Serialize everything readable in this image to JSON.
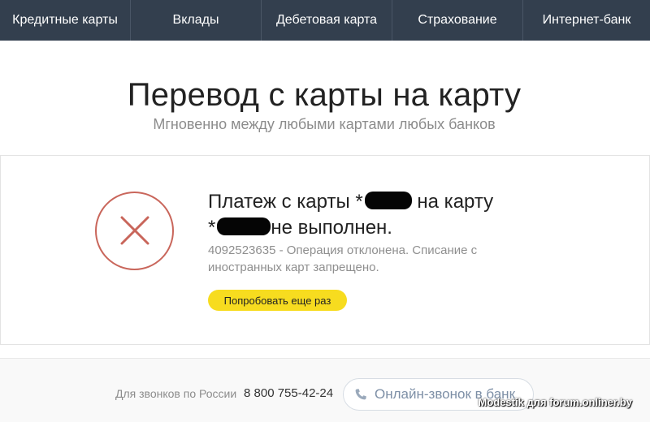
{
  "nav": {
    "items": [
      {
        "label": "Кредитные карты"
      },
      {
        "label": "Вклады"
      },
      {
        "label": "Дебетовая карта"
      },
      {
        "label": "Страхование"
      },
      {
        "label": "Интернет-банк"
      }
    ]
  },
  "header": {
    "title": "Перевод с карты на карту",
    "subtitle": "Мгновенно между любыми картами любых банков"
  },
  "result": {
    "icon": "error-x-icon",
    "status_part1": "Платеж с карты *",
    "status_part2": "на карту",
    "status_part3": "*",
    "status_part4": "не выполнен.",
    "message": "4092523635 - Операция отклонена. Списание с иностранных карт запрещено.",
    "retry_label": "Попробовать еще раз"
  },
  "footer": {
    "phone_label": "Для звонков по России",
    "phone_number": "8 800 755-42-24",
    "call_label": "Онлайн-звонок в банк",
    "call_icon": "phone-icon"
  },
  "watermark": "Modestik для forum.onliner.by",
  "colors": {
    "nav_bg": "#333f4e",
    "accent_yellow": "#f7dc1f",
    "error_red": "#c9665b",
    "muted_text": "#8c8c8c"
  }
}
